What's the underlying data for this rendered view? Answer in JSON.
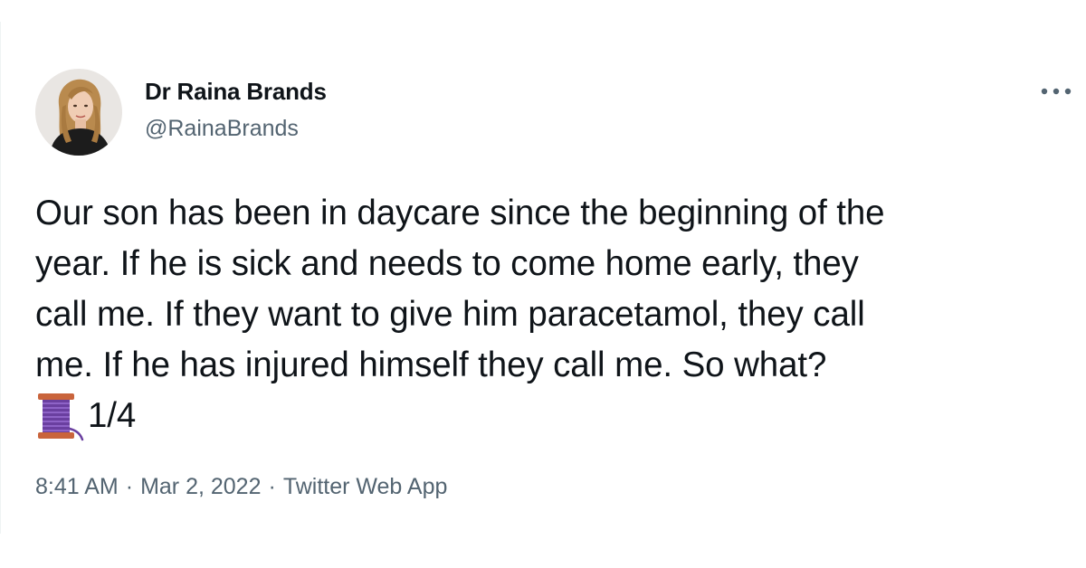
{
  "tweet": {
    "author": {
      "name": "Dr Raina Brands",
      "handle": "@RainaBrands"
    },
    "text_lines": [
      "Our son has been in daycare since the beginning of the",
      "year. If he is sick and needs to come home early, they",
      "call me. If they want to give him paracetamol, they call",
      "me. If he has injured himself they call me. So what?"
    ],
    "thread_emoji": "thread-spool-icon",
    "thread_counter": "1/4",
    "meta": {
      "time": "8:41 AM",
      "separator": "·",
      "date": "Mar 2, 2022",
      "source": "Twitter Web App"
    },
    "more_icon": "more-options-icon"
  },
  "colors": {
    "text_primary": "#0f1419",
    "text_secondary": "#536471",
    "spool_purple": "#6a3fa0",
    "spool_wood": "#c9643c"
  }
}
